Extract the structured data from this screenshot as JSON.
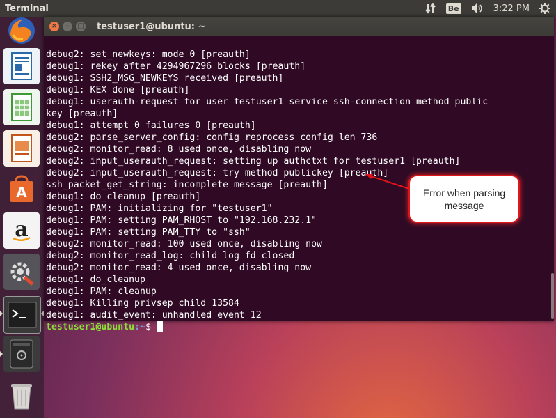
{
  "top_panel": {
    "app_title": "Terminal",
    "keyboard_layout": "Be",
    "clock": "3:22 PM",
    "icons": [
      "network-icon",
      "volume-icon",
      "settings-gear-icon"
    ]
  },
  "launcher": {
    "items": [
      "firefox-icon",
      "libreoffice-writer-icon",
      "libreoffice-calc-icon",
      "libreoffice-impress-icon",
      "ubuntu-software-icon",
      "amazon-icon",
      "system-settings-icon",
      "terminal-icon",
      "disk-icon",
      "trash-icon"
    ]
  },
  "window": {
    "title": "testuser1@ubuntu: ~",
    "buttons": {
      "close": "×",
      "minimize": "–",
      "maximize": "□"
    }
  },
  "terminal": {
    "lines": [
      "debug2: set_newkeys: mode 0 [preauth]",
      "debug1: rekey after 4294967296 blocks [preauth]",
      "debug1: SSH2_MSG_NEWKEYS received [preauth]",
      "debug1: KEX done [preauth]",
      "debug1: userauth-request for user testuser1 service ssh-connection method public",
      "key [preauth]",
      "debug1: attempt 0 failures 0 [preauth]",
      "debug2: parse_server_config: config reprocess config len 736",
      "debug2: monitor_read: 8 used once, disabling now",
      "debug2: input_userauth_request: setting up authctxt for testuser1 [preauth]",
      "debug2: input_userauth_request: try method publickey [preauth]",
      "ssh_packet_get_string: incomplete message [preauth]",
      "debug1: do_cleanup [preauth]",
      "debug1: PAM: initializing for \"testuser1\"",
      "debug1: PAM: setting PAM_RHOST to \"192.168.232.1\"",
      "debug1: PAM: setting PAM_TTY to \"ssh\"",
      "debug2: monitor_read: 100 used once, disabling now",
      "debug2: monitor_read_log: child log fd closed",
      "debug2: monitor_read: 4 used once, disabling now",
      "debug1: do_cleanup",
      "debug1: PAM: cleanup",
      "debug1: Killing privsep child 13584",
      "debug1: audit_event: unhandled event 12"
    ],
    "prompt_user": "testuser1@ubuntu",
    "prompt_path": ":~",
    "prompt_symbol": "$"
  },
  "annotation": {
    "text": "Error when parsing message",
    "color": "#e1141a"
  }
}
